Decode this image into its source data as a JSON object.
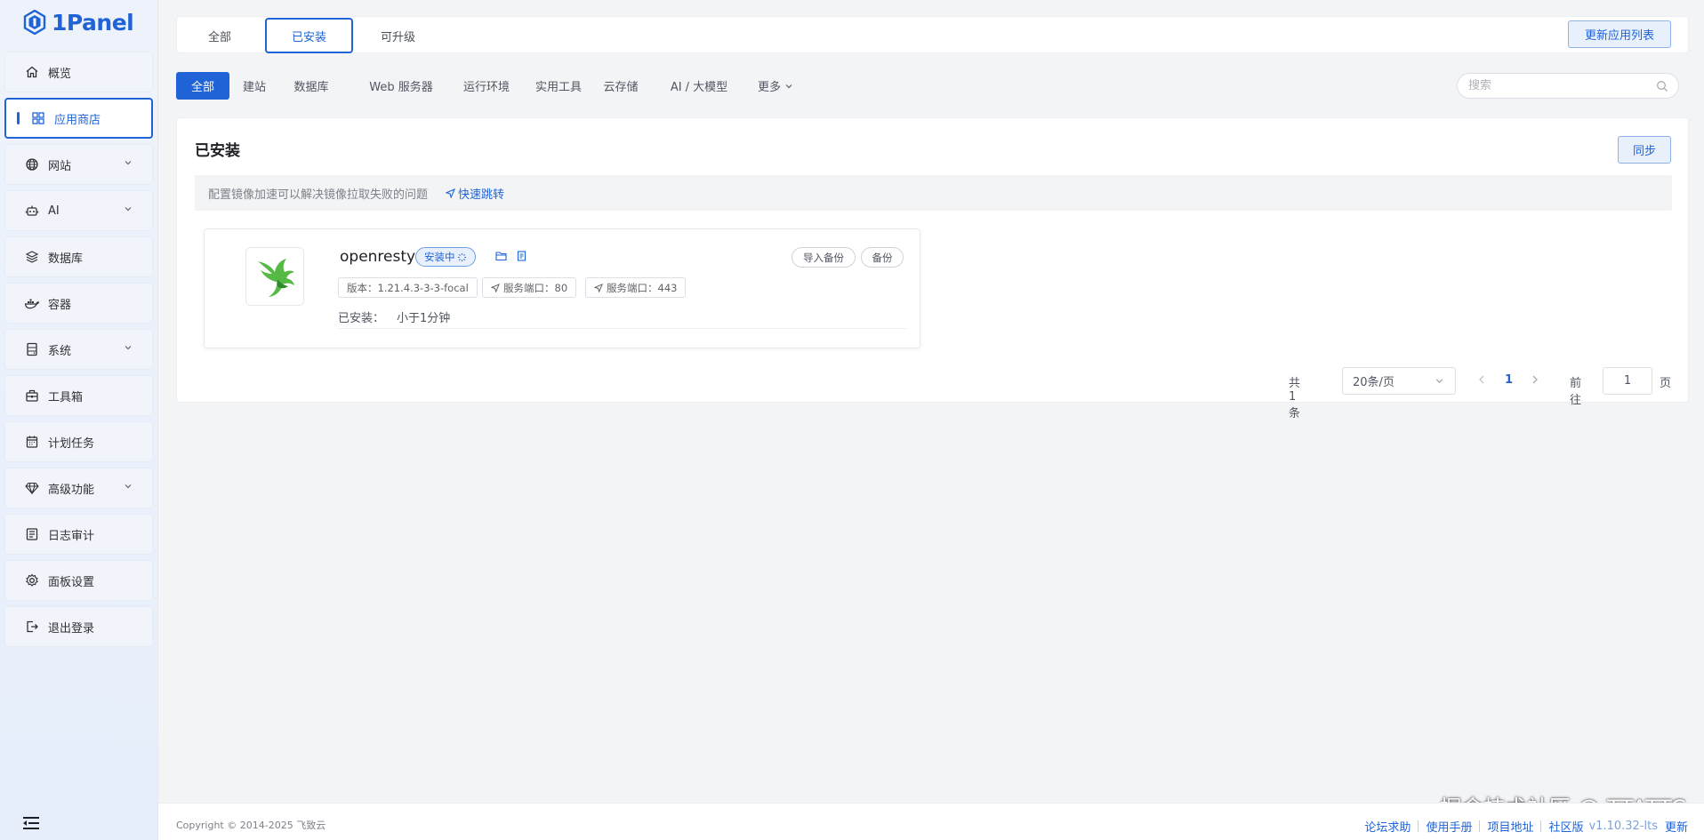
{
  "app": {
    "logo_text": "1Panel"
  },
  "sidebar": {
    "items": [
      {
        "label": "概览",
        "icon": "home-icon",
        "has_children": false
      },
      {
        "label": "应用商店",
        "icon": "app-grid-icon",
        "has_children": false,
        "active": true
      },
      {
        "label": "网站",
        "icon": "globe-icon",
        "has_children": true
      },
      {
        "label": "AI",
        "icon": "robot-icon",
        "has_children": true
      },
      {
        "label": "数据库",
        "icon": "layers-icon",
        "has_children": false
      },
      {
        "label": "容器",
        "icon": "docker-icon",
        "has_children": false
      },
      {
        "label": "系统",
        "icon": "server-icon",
        "has_children": true
      },
      {
        "label": "工具箱",
        "icon": "toolbox-icon",
        "has_children": false
      },
      {
        "label": "计划任务",
        "icon": "calendar-icon",
        "has_children": false
      },
      {
        "label": "高级功能",
        "icon": "diamond-icon",
        "has_children": true
      },
      {
        "label": "日志审计",
        "icon": "log-icon",
        "has_children": false
      },
      {
        "label": "面板设置",
        "icon": "gear-icon",
        "has_children": false
      },
      {
        "label": "退出登录",
        "icon": "logout-icon",
        "has_children": false
      }
    ]
  },
  "top_tabs": {
    "items": [
      "全部",
      "已安装",
      "可升级"
    ],
    "active": "已安装",
    "refresh_label": "更新应用列表"
  },
  "filters": {
    "items": [
      "全部",
      "建站",
      "数据库",
      "Web 服务器",
      "运行环境",
      "实用工具",
      "云存储",
      "AI / 大模型",
      "更多"
    ],
    "active": "全部",
    "search_placeholder": "搜索"
  },
  "installed": {
    "title": "已安装",
    "sync_label": "同步",
    "notice_text": "配置镜像加速可以解决镜像拉取失败的问题",
    "notice_link": "快速跳转",
    "apps": [
      {
        "name": "openresty",
        "status": "安装中",
        "import_backup_label": "导入备份",
        "backup_label": "备份",
        "version": "版本：1.21.4.3-3-3-focal",
        "port1": "服务端口：80",
        "port2": "服务端口：443",
        "installed_label": "已安装：",
        "installed_value": "小于1分钟"
      }
    ]
  },
  "pagination": {
    "total": "共 1 条",
    "page_size": "20条/页",
    "current_page": "1",
    "goto_label": "前往",
    "goto_value": "1",
    "page_unit": "页"
  },
  "footer": {
    "copyright": "Copyright © 2014-2025 飞致云",
    "links": [
      "论坛求助",
      "使用手册",
      "项目地址",
      "社区版"
    ],
    "version": "v1.10.32-lts",
    "update_label": "更新"
  },
  "watermark": "掘金技术社区 @ TTATTC",
  "colors": {
    "accent": "#1f63d6",
    "background": "#f3f4f6"
  }
}
